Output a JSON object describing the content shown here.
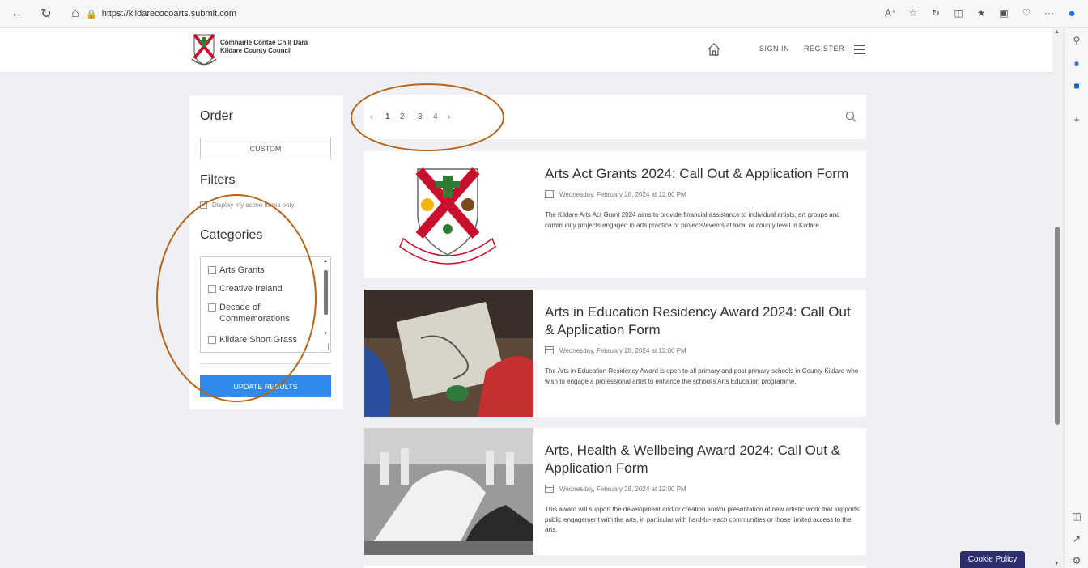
{
  "browser": {
    "url": "https://kildarecocoarts.submit.com",
    "nav_icons": [
      "back-icon",
      "refresh-icon",
      "home-icon"
    ],
    "reader_icon_text": "Aᴀ"
  },
  "header": {
    "council_name_line1": "Comhairle Contae Chill Dara",
    "council_name_line2": "Kildare County Council",
    "sign_in": "SIGN IN",
    "register": "REGISTER"
  },
  "sidebar": {
    "order_heading": "Order",
    "order_value": "CUSTOM",
    "filters_heading": "Filters",
    "active_forms_label": "Display my active forms only",
    "categories_heading": "Categories",
    "categories": [
      {
        "label": "Arts Grants",
        "checked": false
      },
      {
        "label": "Creative Ireland",
        "checked": false
      },
      {
        "label": "Decade of Commemorations",
        "checked": false
      },
      {
        "label": "Kildare Short Grass",
        "checked": false
      }
    ],
    "update_button": "UPDATE RESULTS"
  },
  "pagination": {
    "prev": "‹",
    "pages": [
      "1",
      "2",
      "3",
      "4"
    ],
    "active_page": "1",
    "next": "›"
  },
  "cards": [
    {
      "title": "Arts Act Grants 2024: Call Out & Application Form",
      "date": "Wednesday, February 28, 2024 at 12:00 PM",
      "description": "The Kildare Arts Act Grant 2024 aims to provide financial assistance to individual artists, art groups and community projects engaged in arts practice or projects/events at local or county level in Kildare.",
      "image": "kildare-crest"
    },
    {
      "title": "Arts in Education Residency Award 2024: Call Out & Application Form",
      "date": "Wednesday, February 28, 2024 at 12:00 PM",
      "description": "The Arts in Education Residency Award is open to all primary and post primary schools in County Kildare who wish to engage a professional artist to enhance the school's Arts Education programme.",
      "image": "children-drawing-photo"
    },
    {
      "title": "Arts, Health & Wellbeing Award 2024: Call Out & Application Form",
      "date": "Wednesday, February 28, 2024 at 12:00 PM",
      "description": "This award will support the development and/or creation and/or presentation of new artistic work that supports public engagement with the arts, in particular with hard-to-reach communities or those limited access to the arts.",
      "image": "dance-class-photo"
    }
  ],
  "cookie_button": "Cookie Policy",
  "colors": {
    "primary_button": "#2f8aeb",
    "annotation": "#b5651d",
    "cookie_bg": "#2c2f6b",
    "page_bg": "#eef0f4"
  }
}
